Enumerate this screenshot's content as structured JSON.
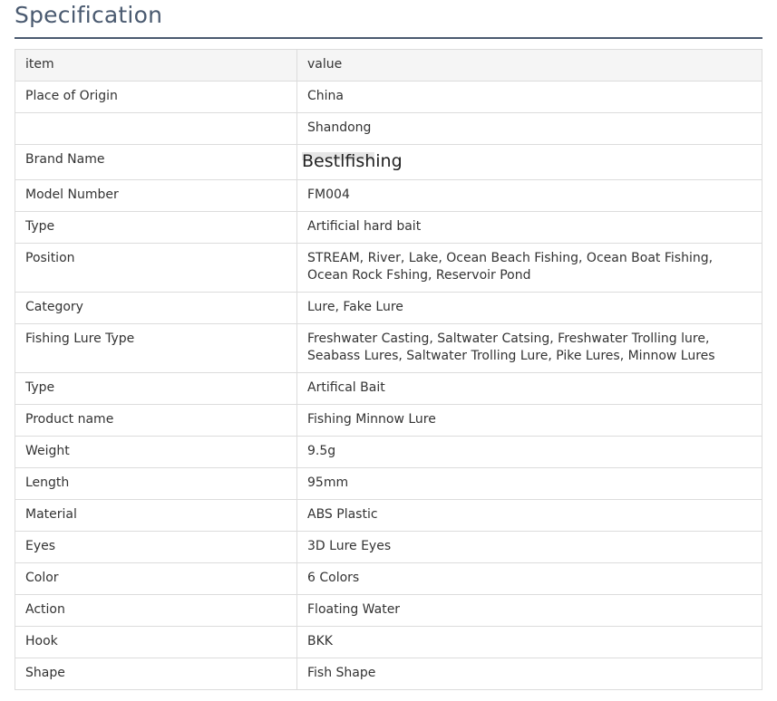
{
  "section_title": "Specification",
  "table": {
    "header": {
      "item": "item",
      "value": "value"
    },
    "rows": [
      {
        "item": "Place of Origin",
        "value": "China"
      },
      {
        "item": "",
        "value": "Shandong"
      },
      {
        "item": "Brand Name",
        "value": "Bestlfishing"
      },
      {
        "item": "Model Number",
        "value": "FM004"
      },
      {
        "item": "Type",
        "value": "Artificial hard bait"
      },
      {
        "item": "Position",
        "value": "STREAM, River, Lake, Ocean Beach Fishing, Ocean Boat Fishing, Ocean Rock Fshing, Reservoir Pond"
      },
      {
        "item": "Category",
        "value": "Lure, Fake Lure"
      },
      {
        "item": "Fishing Lure Type",
        "value": "Freshwater Casting, Saltwater Catsing, Freshwater Trolling lure, Seabass Lures, Saltwater Trolling Lure, Pike Lures, Minnow Lures"
      },
      {
        "item": "Type",
        "value": "Artifical Bait"
      },
      {
        "item": "Product name",
        "value": "Fishing Minnow Lure"
      },
      {
        "item": "Weight",
        "value": "9.5g"
      },
      {
        "item": "Length",
        "value": "95mm"
      },
      {
        "item": "Material",
        "value": "ABS Plastic"
      },
      {
        "item": "Eyes",
        "value": "3D Lure Eyes"
      },
      {
        "item": "Color",
        "value": "6 Colors"
      },
      {
        "item": "Action",
        "value": "Floating Water"
      },
      {
        "item": "Hook",
        "value": "BKK"
      },
      {
        "item": "Shape",
        "value": "Fish Shape"
      }
    ]
  }
}
